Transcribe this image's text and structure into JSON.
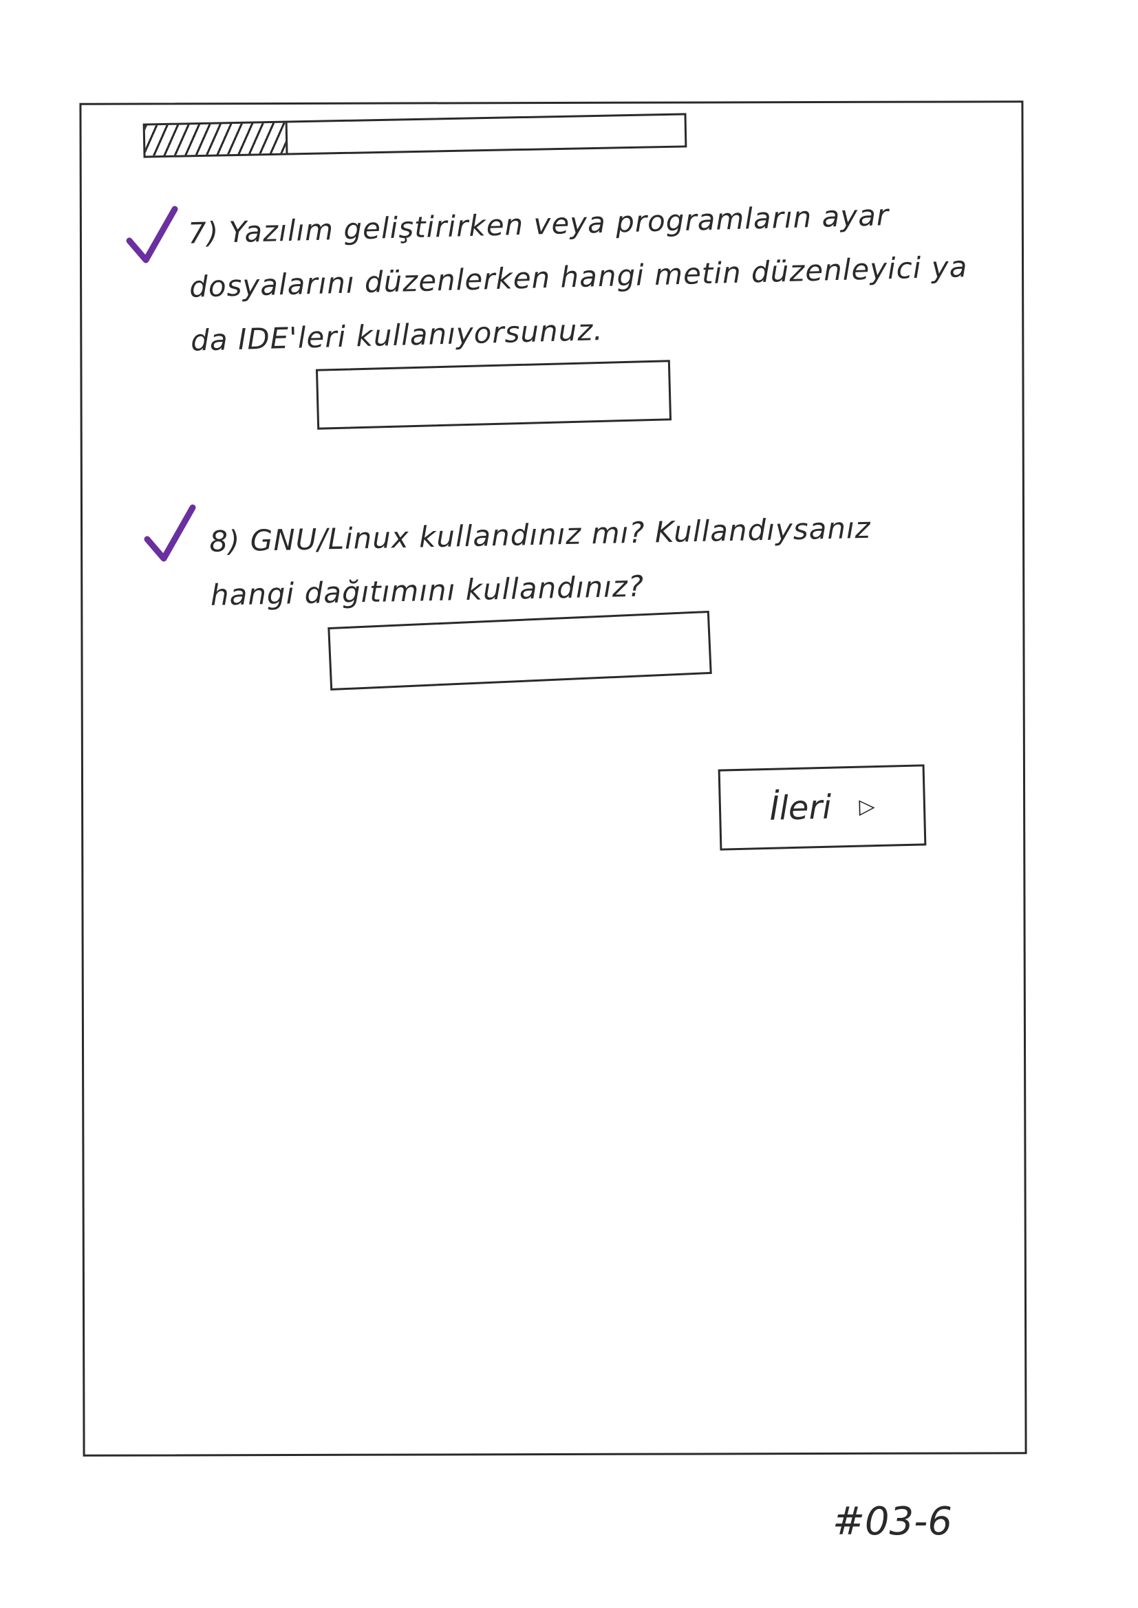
{
  "progress": {
    "value": 0.26
  },
  "questions": [
    {
      "text": "7) Yazılım geliştirirken veya programların ayar dosyalarını düzenlerken hangi metin düzenleyici ya da IDE'leri kullanıyorsunuz.",
      "answer": "",
      "checked": true
    },
    {
      "text": "8) GNU/Linux kullandınız mı? Kullandıysanız hangi dağıtımını kullandınız?",
      "answer": "",
      "checked": true
    }
  ],
  "next_button": {
    "label": "İleri",
    "icon": "arrow-right-icon"
  },
  "page_code": "#03-6",
  "colors": {
    "checkmark": "#6a2fa0",
    "ink": "#2a2a2a"
  }
}
